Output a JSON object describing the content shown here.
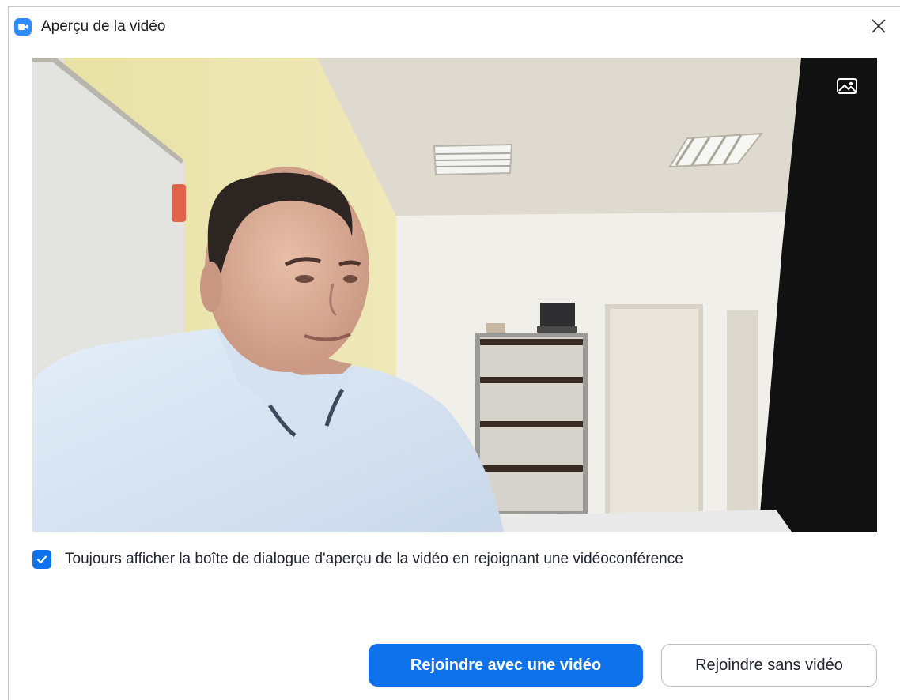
{
  "window": {
    "title": "Aperçu de la vidéo",
    "app_icon": "zoom-camera-icon",
    "close_icon": "close-icon"
  },
  "preview": {
    "image_description_icon": "video-preview",
    "background_toggle_icon": "virtual-background-icon"
  },
  "options": {
    "always_show_checked": true,
    "always_show_label": "Toujours afficher la boîte de dialogue d'aperçu de la vidéo en rejoignant une vidéoconférence"
  },
  "actions": {
    "join_with_video_label": "Rejoindre avec une vidéo",
    "join_without_video_label": "Rejoindre sans vidéo"
  },
  "colors": {
    "accent": "#0e72ed",
    "app_icon": "#2d8cff",
    "text": "#232333"
  }
}
